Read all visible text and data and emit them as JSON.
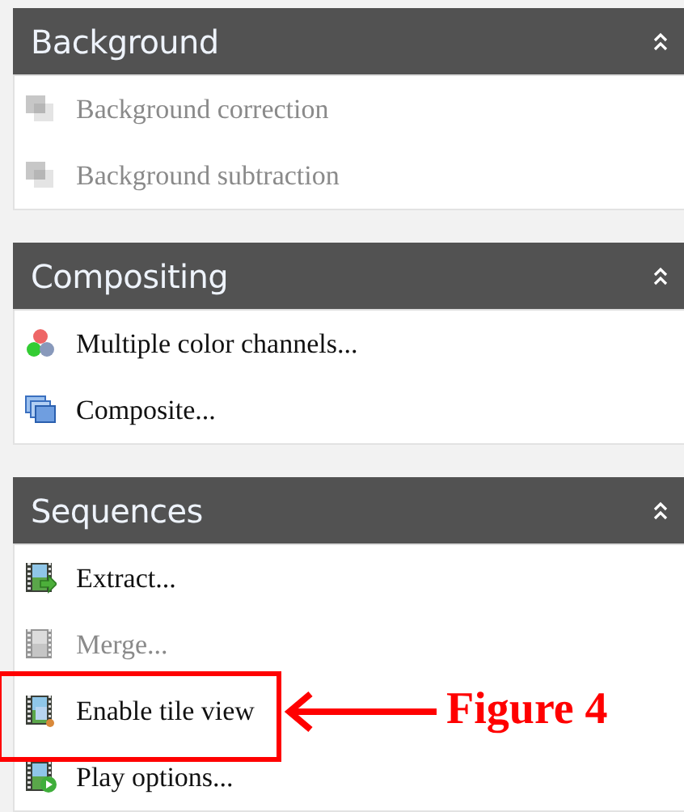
{
  "panels": [
    {
      "title": "Background",
      "expanded": true,
      "items": [
        {
          "label": "Background correction",
          "kind": "layers",
          "disabled": true,
          "highlighted": false
        },
        {
          "label": "Background subtraction",
          "kind": "layers",
          "disabled": true,
          "highlighted": false
        }
      ]
    },
    {
      "title": "Compositing",
      "expanded": true,
      "items": [
        {
          "label": "Multiple color channels...",
          "kind": "channels",
          "disabled": false,
          "highlighted": false
        },
        {
          "label": "Composite...",
          "kind": "composite",
          "disabled": false,
          "highlighted": false
        }
      ]
    },
    {
      "title": "Sequences",
      "expanded": true,
      "items": [
        {
          "label": "Extract...",
          "kind": "extract",
          "disabled": false,
          "highlighted": false
        },
        {
          "label": "Merge...",
          "kind": "merge",
          "disabled": true,
          "highlighted": false
        },
        {
          "label": "Enable tile view",
          "kind": "tile",
          "disabled": false,
          "highlighted": true
        },
        {
          "label": "Play options...",
          "kind": "play",
          "disabled": false,
          "highlighted": false
        }
      ]
    }
  ],
  "annotation": {
    "label": "Figure 4"
  }
}
